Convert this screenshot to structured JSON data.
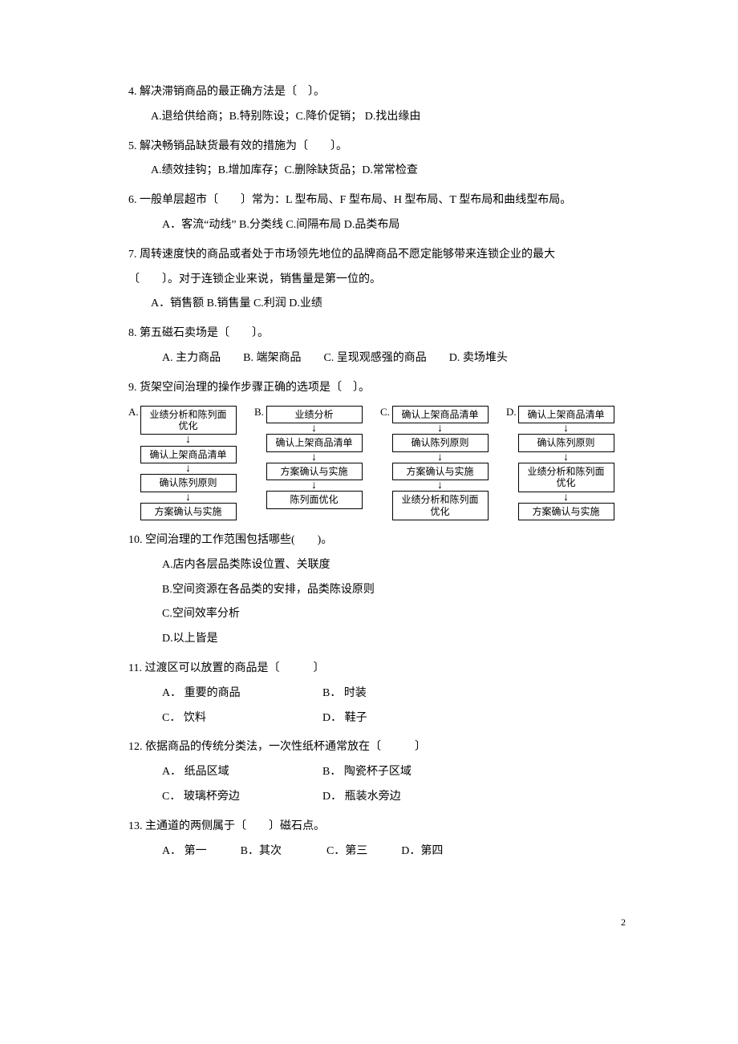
{
  "q4": {
    "stem": "4. 解决滞销商品的最正确方法是〔　〕。",
    "opts": "A.退给供给商；B.特别陈设；C.降价促销； D.找出缘由"
  },
  "q5": {
    "stem": "5. 解决畅销品缺货最有效的措施为〔　　〕。",
    "opts": "A.绩效挂钩；B.增加库存；C.删除缺货品；D.常常检查"
  },
  "q6": {
    "stem": "6. 一般单层超市〔　　〕常为：L 型布局、F 型布局、H 型布局、T 型布局和曲线型布局。",
    "opts": "A．客流“动线”  B.分类线  C.间隔布局  D.品类布局"
  },
  "q7": {
    "stem1": "7. 周转速度快的商品或者处于市场领先地位的品牌商品不愿定能够带来连锁企业的最大",
    "stem2": "〔　　〕。对于连锁企业来说，销售量是第一位的。",
    "opts": "A．销售额  B.销售量  C.利润  D.业绩"
  },
  "q8": {
    "stem": "8. 第五磁石卖场是〔　　〕。",
    "opts": "A. 主力商品　　B. 端架商品　　C. 呈现观感强的商品　　D. 卖场堆头"
  },
  "q9": {
    "stem": "9. 货架空间治理的操作步骤正确的选项是〔　〕。",
    "flowA": {
      "label": "A.",
      "s1": "业绩分析和陈列面优化",
      "s2": "确认上架商品清单",
      "s3": "确认陈列原则",
      "s4": "方案确认与实施"
    },
    "flowB": {
      "label": "B.",
      "s1": "业绩分析",
      "s2": "确认上架商品清单",
      "s3": "方案确认与实施",
      "s4": "陈列面优化"
    },
    "flowC": {
      "label": "C.",
      "s1": "确认上架商品清单",
      "s2": "确认陈列原则",
      "s3": "方案确认与实施",
      "s4": "业绩分析和陈列面优化"
    },
    "flowD": {
      "label": "D.",
      "s1": "确认上架商品清单",
      "s2": "确认陈列原则",
      "s3": "业绩分析和陈列面优化",
      "s4": "方案确认与实施"
    }
  },
  "q10": {
    "stem": "10. 空间治理的工作范围包括哪些(　　)。",
    "a": "A.店内各层品类陈设位置、关联度",
    "b": "B.空间资源在各品类的安排，品类陈设原则",
    "c": "C.空间效率分析",
    "d": "D.以上皆是"
  },
  "q11": {
    "stem": "11. 过渡区可以放置的商品是〔　　　〕",
    "a": "A． 重要的商品",
    "b": "B． 时装",
    "c": "C． 饮料",
    "d": "D． 鞋子"
  },
  "q12": {
    "stem": "12. 依据商品的传统分类法，一次性纸杯通常放在〔　　　〕",
    "a": "A． 纸品区域",
    "b": "B． 陶瓷杯子区域",
    "c": "C． 玻璃杯旁边",
    "d": "D． 瓶装水旁边"
  },
  "q13": {
    "stem": "13. 主通道的两侧属于〔　　〕磁石点。",
    "opts": "A． 第一　　　B．其次　　　　C．第三　　　D．第四"
  },
  "pageNum": "2"
}
